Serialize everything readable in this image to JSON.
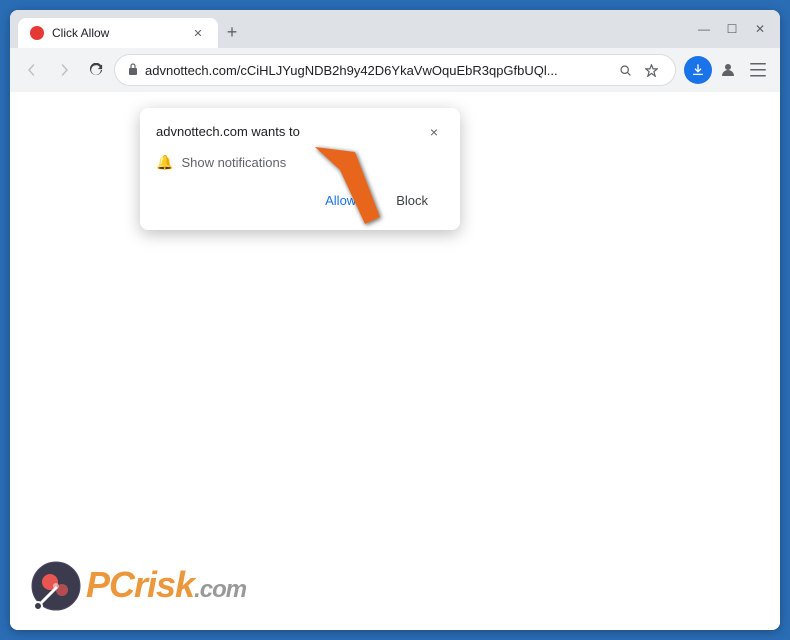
{
  "browser": {
    "title": "Click Allow",
    "url": "advnottech.com/cCiHLJYugNDB2h9y42D6YkaVwOquEbR3qpGfbUQl...",
    "tab": {
      "title": "Click Allow",
      "favicon_color": "#e53935"
    }
  },
  "popup": {
    "title": "advnottech.com wants to",
    "notification_label": "Show notifications",
    "allow_button": "Allow",
    "block_button": "Block",
    "close_label": "×"
  },
  "watermark": {
    "pc_text": "PC",
    "risk_text": "risk",
    "domain_text": ".com"
  },
  "nav": {
    "back_label": "←",
    "forward_label": "→",
    "reload_label": "↻",
    "more_label": "⋮",
    "search_icon": "🔍",
    "bookmark_icon": "☆",
    "profile_icon": "👤"
  },
  "colors": {
    "arrow_orange": "#e8651a",
    "chrome_tab_bg": "#dee1e6",
    "accent_blue": "#1a73e8"
  }
}
